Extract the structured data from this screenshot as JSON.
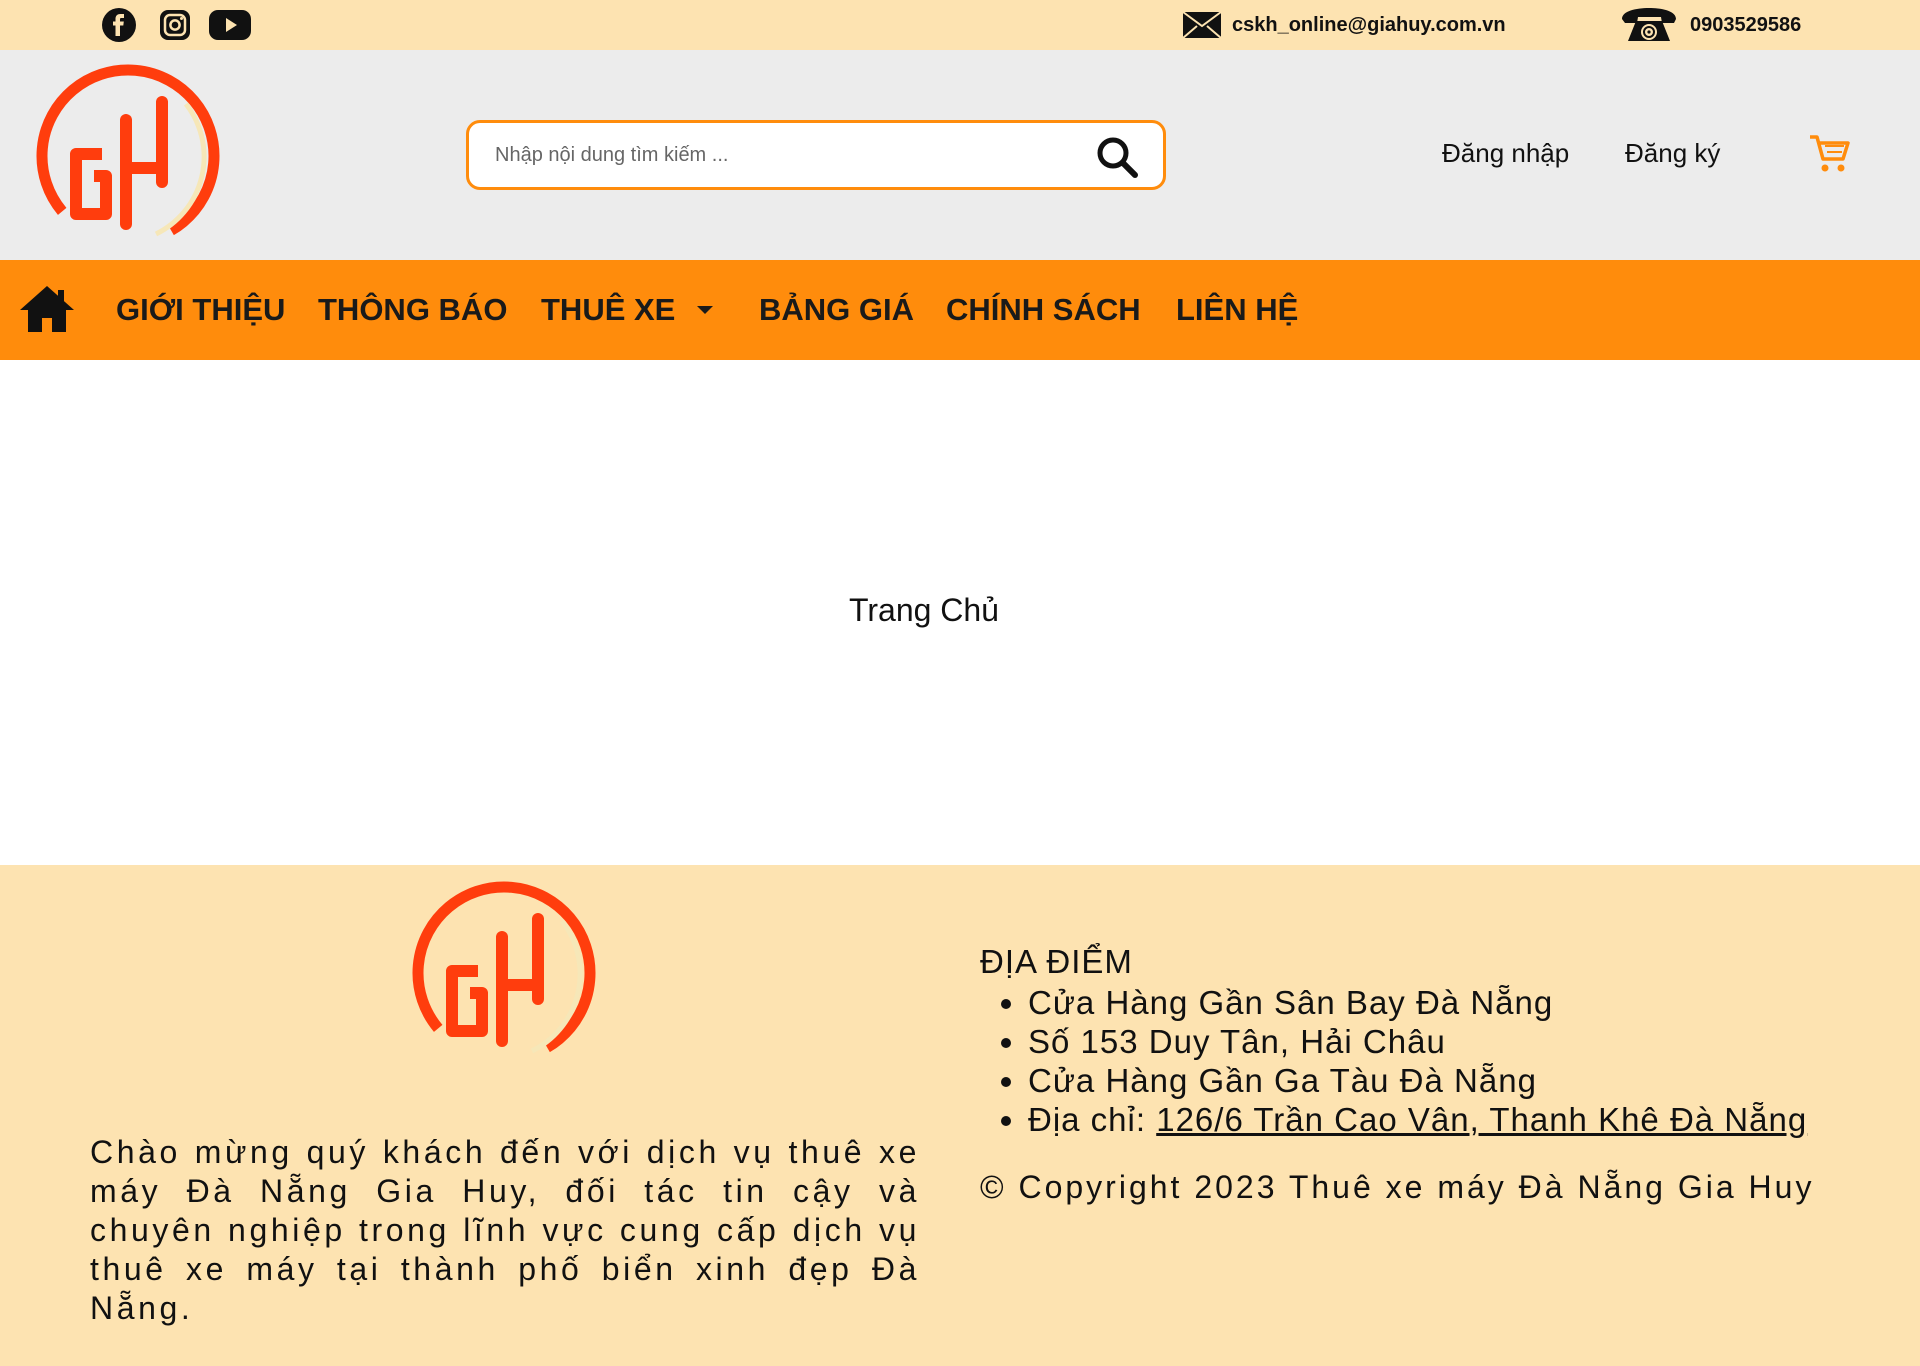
{
  "topbar": {
    "social": [
      {
        "icon": "facebook-icon"
      },
      {
        "icon": "instagram-icon"
      },
      {
        "icon": "youtube-icon"
      }
    ],
    "email": "cskh_online@giahuy.com.vn",
    "phone": "0903529586"
  },
  "header": {
    "search_placeholder": "Nhập nội dung tìm kiếm ...",
    "login_label": "Đăng nhập",
    "register_label": "Đăng ký"
  },
  "nav": {
    "items": [
      {
        "label": "GIỚI THIỆU"
      },
      {
        "label": "THÔNG BÁO"
      },
      {
        "label": "THUÊ XE"
      },
      {
        "label": "BẢNG GIÁ"
      },
      {
        "label": "CHÍNH SÁCH"
      },
      {
        "label": "LIÊN HỆ"
      }
    ]
  },
  "main": {
    "title": "Trang Chủ"
  },
  "footer": {
    "description": "Chào mừng quý khách đến với dịch vụ thuê xe máy Đà Nẵng Gia Huy, đối tác tin cậy và chuyên nghiệp trong lĩnh vực cung cấp dịch vụ thuê xe máy tại thành phố biển xinh đẹp Đà Nẵng.",
    "locations_title": "ĐỊA ĐIỂM",
    "locations": [
      "Cửa Hàng Gần Sân Bay Đà Nẵng",
      "Số 153 Duy Tân, Hải Châu",
      "Cửa Hàng Gần Ga Tàu Đà Nẵng"
    ],
    "address_prefix": "Địa chỉ: ",
    "address_link": "126/6 Trần Cao Vân, Thanh Khê Đà Nẵng",
    "copyright": "© Copyright 2023 Thuê xe máy Đà Nẵng Gia Huy"
  },
  "colors": {
    "topbar_bg": "#fde3b1",
    "header_bg": "#ececec",
    "accent": "#ff8c0c",
    "logo_red": "#ff3d0d"
  }
}
